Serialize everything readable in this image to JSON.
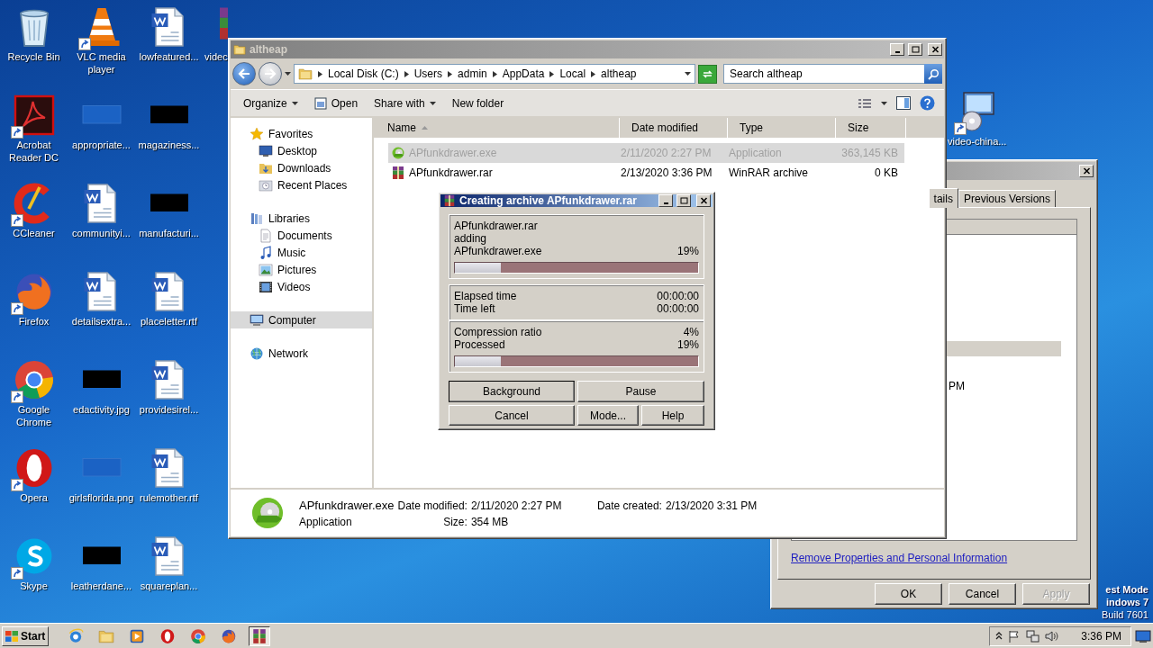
{
  "desktop_icons": [
    {
      "label": "Recycle Bin",
      "kind": "recycle",
      "shortcut": false
    },
    {
      "label": "Acrobat Reader DC",
      "kind": "pdf",
      "shortcut": true
    },
    {
      "label": "CCleaner",
      "kind": "ccleaner",
      "shortcut": true
    },
    {
      "label": "Firefox",
      "kind": "firefox",
      "shortcut": true
    },
    {
      "label": "Google Chrome",
      "kind": "chrome",
      "shortcut": true
    },
    {
      "label": "Opera",
      "kind": "opera",
      "shortcut": true
    },
    {
      "label": "Skype",
      "kind": "skype",
      "shortcut": true
    },
    {
      "label": "VLC media player",
      "kind": "cone",
      "shortcut": true
    },
    {
      "label": "appropriate...",
      "kind": "faint",
      "shortcut": false
    },
    {
      "label": "communityi...",
      "kind": "document",
      "shortcut": false
    },
    {
      "label": "detailsextra...",
      "kind": "document",
      "shortcut": false
    },
    {
      "label": "edactivity.jpg",
      "kind": "redacted",
      "shortcut": false
    },
    {
      "label": "girlsflorida.png",
      "kind": "faint",
      "shortcut": false
    },
    {
      "label": "leatherdane...",
      "kind": "redacted",
      "shortcut": false
    },
    {
      "label": "lowfeatured...",
      "kind": "document",
      "shortcut": false
    },
    {
      "label": "magaziness...",
      "kind": "redacted",
      "shortcut": false
    },
    {
      "label": "manufacturi...",
      "kind": "redacted",
      "shortcut": false
    },
    {
      "label": "placeletter.rtf",
      "kind": "document",
      "shortcut": false
    },
    {
      "label": "providesirel...",
      "kind": "document",
      "shortcut": false
    },
    {
      "label": "rulemother.rtf",
      "kind": "document",
      "shortcut": false
    },
    {
      "label": "squareplan...",
      "kind": "document",
      "shortcut": false
    }
  ],
  "desktop_partial_icon": {
    "label": "videc",
    "kind": "archive"
  },
  "desktop_right_icon": {
    "label": "video-china...",
    "kind": "disc",
    "shortcut": true
  },
  "desktop_notice": [
    "est Mode",
    "indows 7",
    "Build 7601"
  ],
  "properties_window": {
    "tabs": [
      {
        "label": "tails",
        "selected": true
      },
      {
        "label": "Previous Versions",
        "selected": false
      }
    ],
    "time_fragment": "PM",
    "link": "Remove Properties and Personal Information",
    "buttons": [
      {
        "label": "OK",
        "disabled": false
      },
      {
        "label": "Cancel",
        "disabled": false
      },
      {
        "label": "Apply",
        "disabled": true
      }
    ]
  },
  "explorer": {
    "title": "altheap",
    "breadcrumb": [
      "Local Disk (C:)",
      "Users",
      "admin",
      "AppData",
      "Local",
      "altheap"
    ],
    "search": {
      "placeholder": "Search altheap"
    },
    "toolbar": [
      {
        "label": "Organize",
        "kind": "menu"
      },
      {
        "label": "Open",
        "kind": "icon"
      },
      {
        "label": "Share with",
        "kind": "menu"
      },
      {
        "label": "New folder",
        "kind": "plain"
      }
    ],
    "nav": [
      {
        "label": "Favorites",
        "kind": "star",
        "selected": false,
        "children": [
          {
            "label": "Desktop",
            "kind": "desktop",
            "selected": false
          },
          {
            "label": "Downloads",
            "kind": "downloads",
            "selected": false
          },
          {
            "label": "Recent Places",
            "kind": "recent",
            "selected": false
          }
        ]
      },
      {
        "label": "Libraries",
        "kind": "library",
        "selected": false,
        "children": [
          {
            "label": "Documents",
            "kind": "documents",
            "selected": false
          },
          {
            "label": "Music",
            "kind": "music",
            "selected": false
          },
          {
            "label": "Pictures",
            "kind": "pictures",
            "selected": false
          },
          {
            "label": "Videos",
            "kind": "videos",
            "selected": false
          }
        ]
      },
      {
        "label": "Computer",
        "kind": "computer",
        "selected": true
      },
      {
        "label": "Network",
        "kind": "network",
        "selected": false
      }
    ],
    "columns": [
      "Name",
      "Date modified",
      "Type",
      "Size"
    ],
    "rows": [
      {
        "name": "APfunkdrawer.exe",
        "kind": "iso",
        "date": "2/11/2020 2:27 PM",
        "type": "Application",
        "size": "363,145 KB",
        "selected": true
      },
      {
        "name": "APfunkdrawer.rar",
        "kind": "archive",
        "date": "2/13/2020 3:36 PM",
        "type": "WinRAR archive",
        "size": "0 KB",
        "selected": false
      }
    ],
    "details": {
      "name": "APfunkdrawer.exe",
      "type": "Application",
      "modified_label": "Date modified:",
      "modified": "2/11/2020 2:27 PM",
      "size_label": "Size:",
      "size": "354 MB",
      "created_label": "Date created:",
      "created": "2/13/2020 3:31 PM"
    }
  },
  "rar_dialog": {
    "title": "Creating archive APfunkdrawer.rar",
    "archive": "APfunkdrawer.rar",
    "action": "adding",
    "file": "APfunkdrawer.exe",
    "file_percent": "19%",
    "file_bar": {
      "level": 0.19
    },
    "times": [
      {
        "label": "Elapsed time",
        "value": "00:00:00"
      },
      {
        "label": "Time left",
        "value": "00:00:00"
      }
    ],
    "stats": [
      {
        "label": "Compression ratio",
        "value": "4%"
      },
      {
        "label": "Processed",
        "value": "19%"
      }
    ],
    "total_bar": {
      "level": 0.19
    },
    "buttons": [
      {
        "label": "Background",
        "focused": true
      },
      {
        "label": "Pause",
        "focused": false
      },
      {
        "label": "Cancel",
        "focused": false
      },
      {
        "label": "Mode...",
        "focused": false
      },
      {
        "label": "Help",
        "focused": false
      }
    ]
  },
  "taskbar": {
    "start": "Start",
    "apps": [
      {
        "kind": "ie",
        "selected": false
      },
      {
        "kind": "folder",
        "selected": false
      },
      {
        "kind": "media",
        "selected": false
      },
      {
        "kind": "opera",
        "selected": false
      },
      {
        "kind": "chrome",
        "selected": false
      },
      {
        "kind": "firefox",
        "selected": false
      },
      {
        "kind": "archive",
        "selected": true
      }
    ],
    "time": "3:36 PM"
  }
}
